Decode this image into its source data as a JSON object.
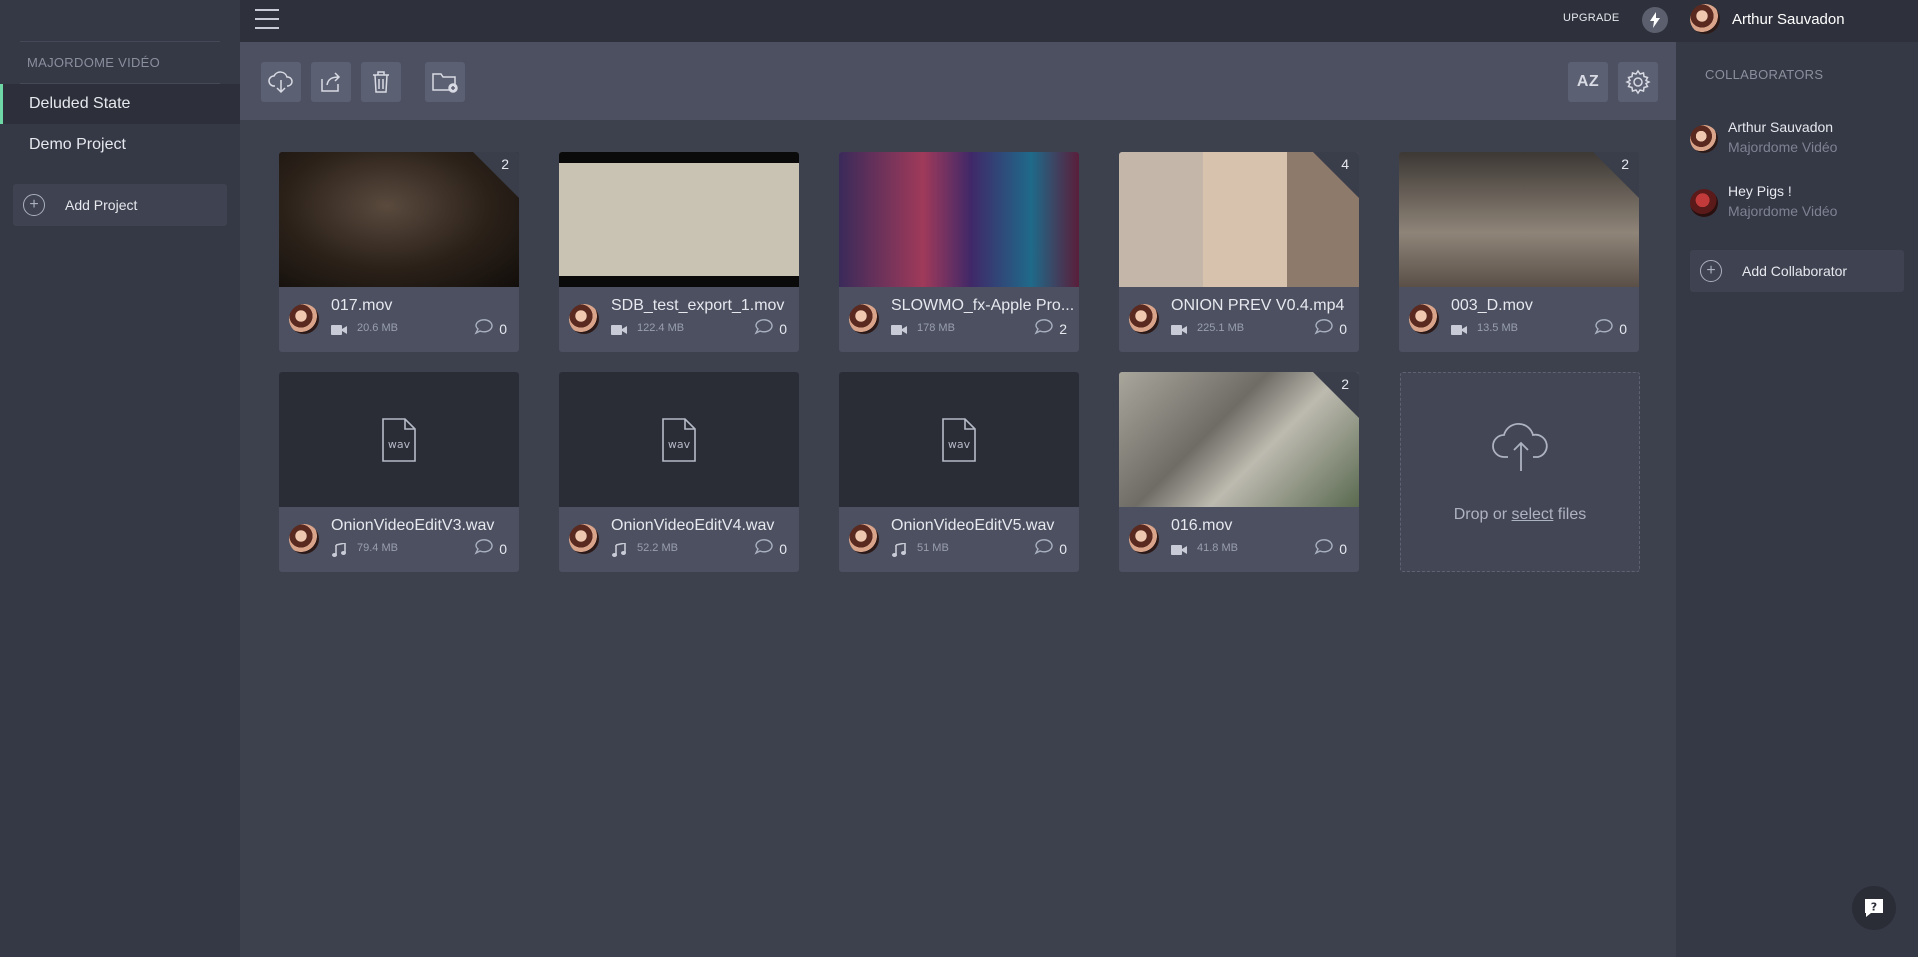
{
  "sidebar": {
    "team_name": "MAJORDOME VIDÉO",
    "projects": [
      {
        "label": "Deluded State",
        "active": true
      },
      {
        "label": "Demo Project",
        "active": false
      }
    ],
    "add_project_label": "Add Project"
  },
  "topbar": {
    "upgrade_label": "UPGRADE",
    "user_name": "Arthur Sauvadon"
  },
  "toolbar": {
    "sort_label": "AZ"
  },
  "files": [
    {
      "name": "017.mov",
      "type": "video",
      "size": "20.6 MB",
      "comments": "0",
      "versions": "2"
    },
    {
      "name": "SDB_test_export_1.mov",
      "type": "video",
      "size": "122.4 MB",
      "comments": "0",
      "versions": ""
    },
    {
      "name": "SLOWMO_fx-Apple Pro...",
      "type": "video",
      "size": "178 MB",
      "comments": "2",
      "versions": ""
    },
    {
      "name": "ONION PREV V0.4.mp4",
      "type": "video",
      "size": "225.1 MB",
      "comments": "0",
      "versions": "4"
    },
    {
      "name": "003_D.mov",
      "type": "video",
      "size": "13.5 MB",
      "comments": "0",
      "versions": "2"
    },
    {
      "name": "OnionVideoEditV3.wav",
      "type": "audio",
      "size": "79.4 MB",
      "comments": "0",
      "versions": "",
      "placeholder": "wav"
    },
    {
      "name": "OnionVideoEditV4.wav",
      "type": "audio",
      "size": "52.2 MB",
      "comments": "0",
      "versions": "",
      "placeholder": "wav"
    },
    {
      "name": "OnionVideoEditV5.wav",
      "type": "audio",
      "size": "51 MB",
      "comments": "0",
      "versions": "",
      "placeholder": "wav"
    },
    {
      "name": "016.mov",
      "type": "video",
      "size": "41.8 MB",
      "comments": "0",
      "versions": "2"
    }
  ],
  "dropzone": {
    "text_before": "Drop or ",
    "link": "select",
    "text_after": " files"
  },
  "collaborators": {
    "title": "COLLABORATORS",
    "items": [
      {
        "name": "Arthur Sauvadon",
        "team": "Majordome Vidéo"
      },
      {
        "name": "Hey Pigs !",
        "team": "Majordome Vidéo"
      }
    ],
    "add_label": "Add Collaborator"
  },
  "icons": {
    "download": "cloud-download-icon",
    "share": "share-icon",
    "delete": "trash-icon",
    "new_folder": "folder-add-icon",
    "settings": "gear-icon",
    "upload": "cloud-upload-icon",
    "help": "help-chat-icon",
    "bolt": "bolt-icon"
  },
  "colors": {
    "accent": "#6fd6a6",
    "background": "#3d404d",
    "card": "#4c5061"
  }
}
